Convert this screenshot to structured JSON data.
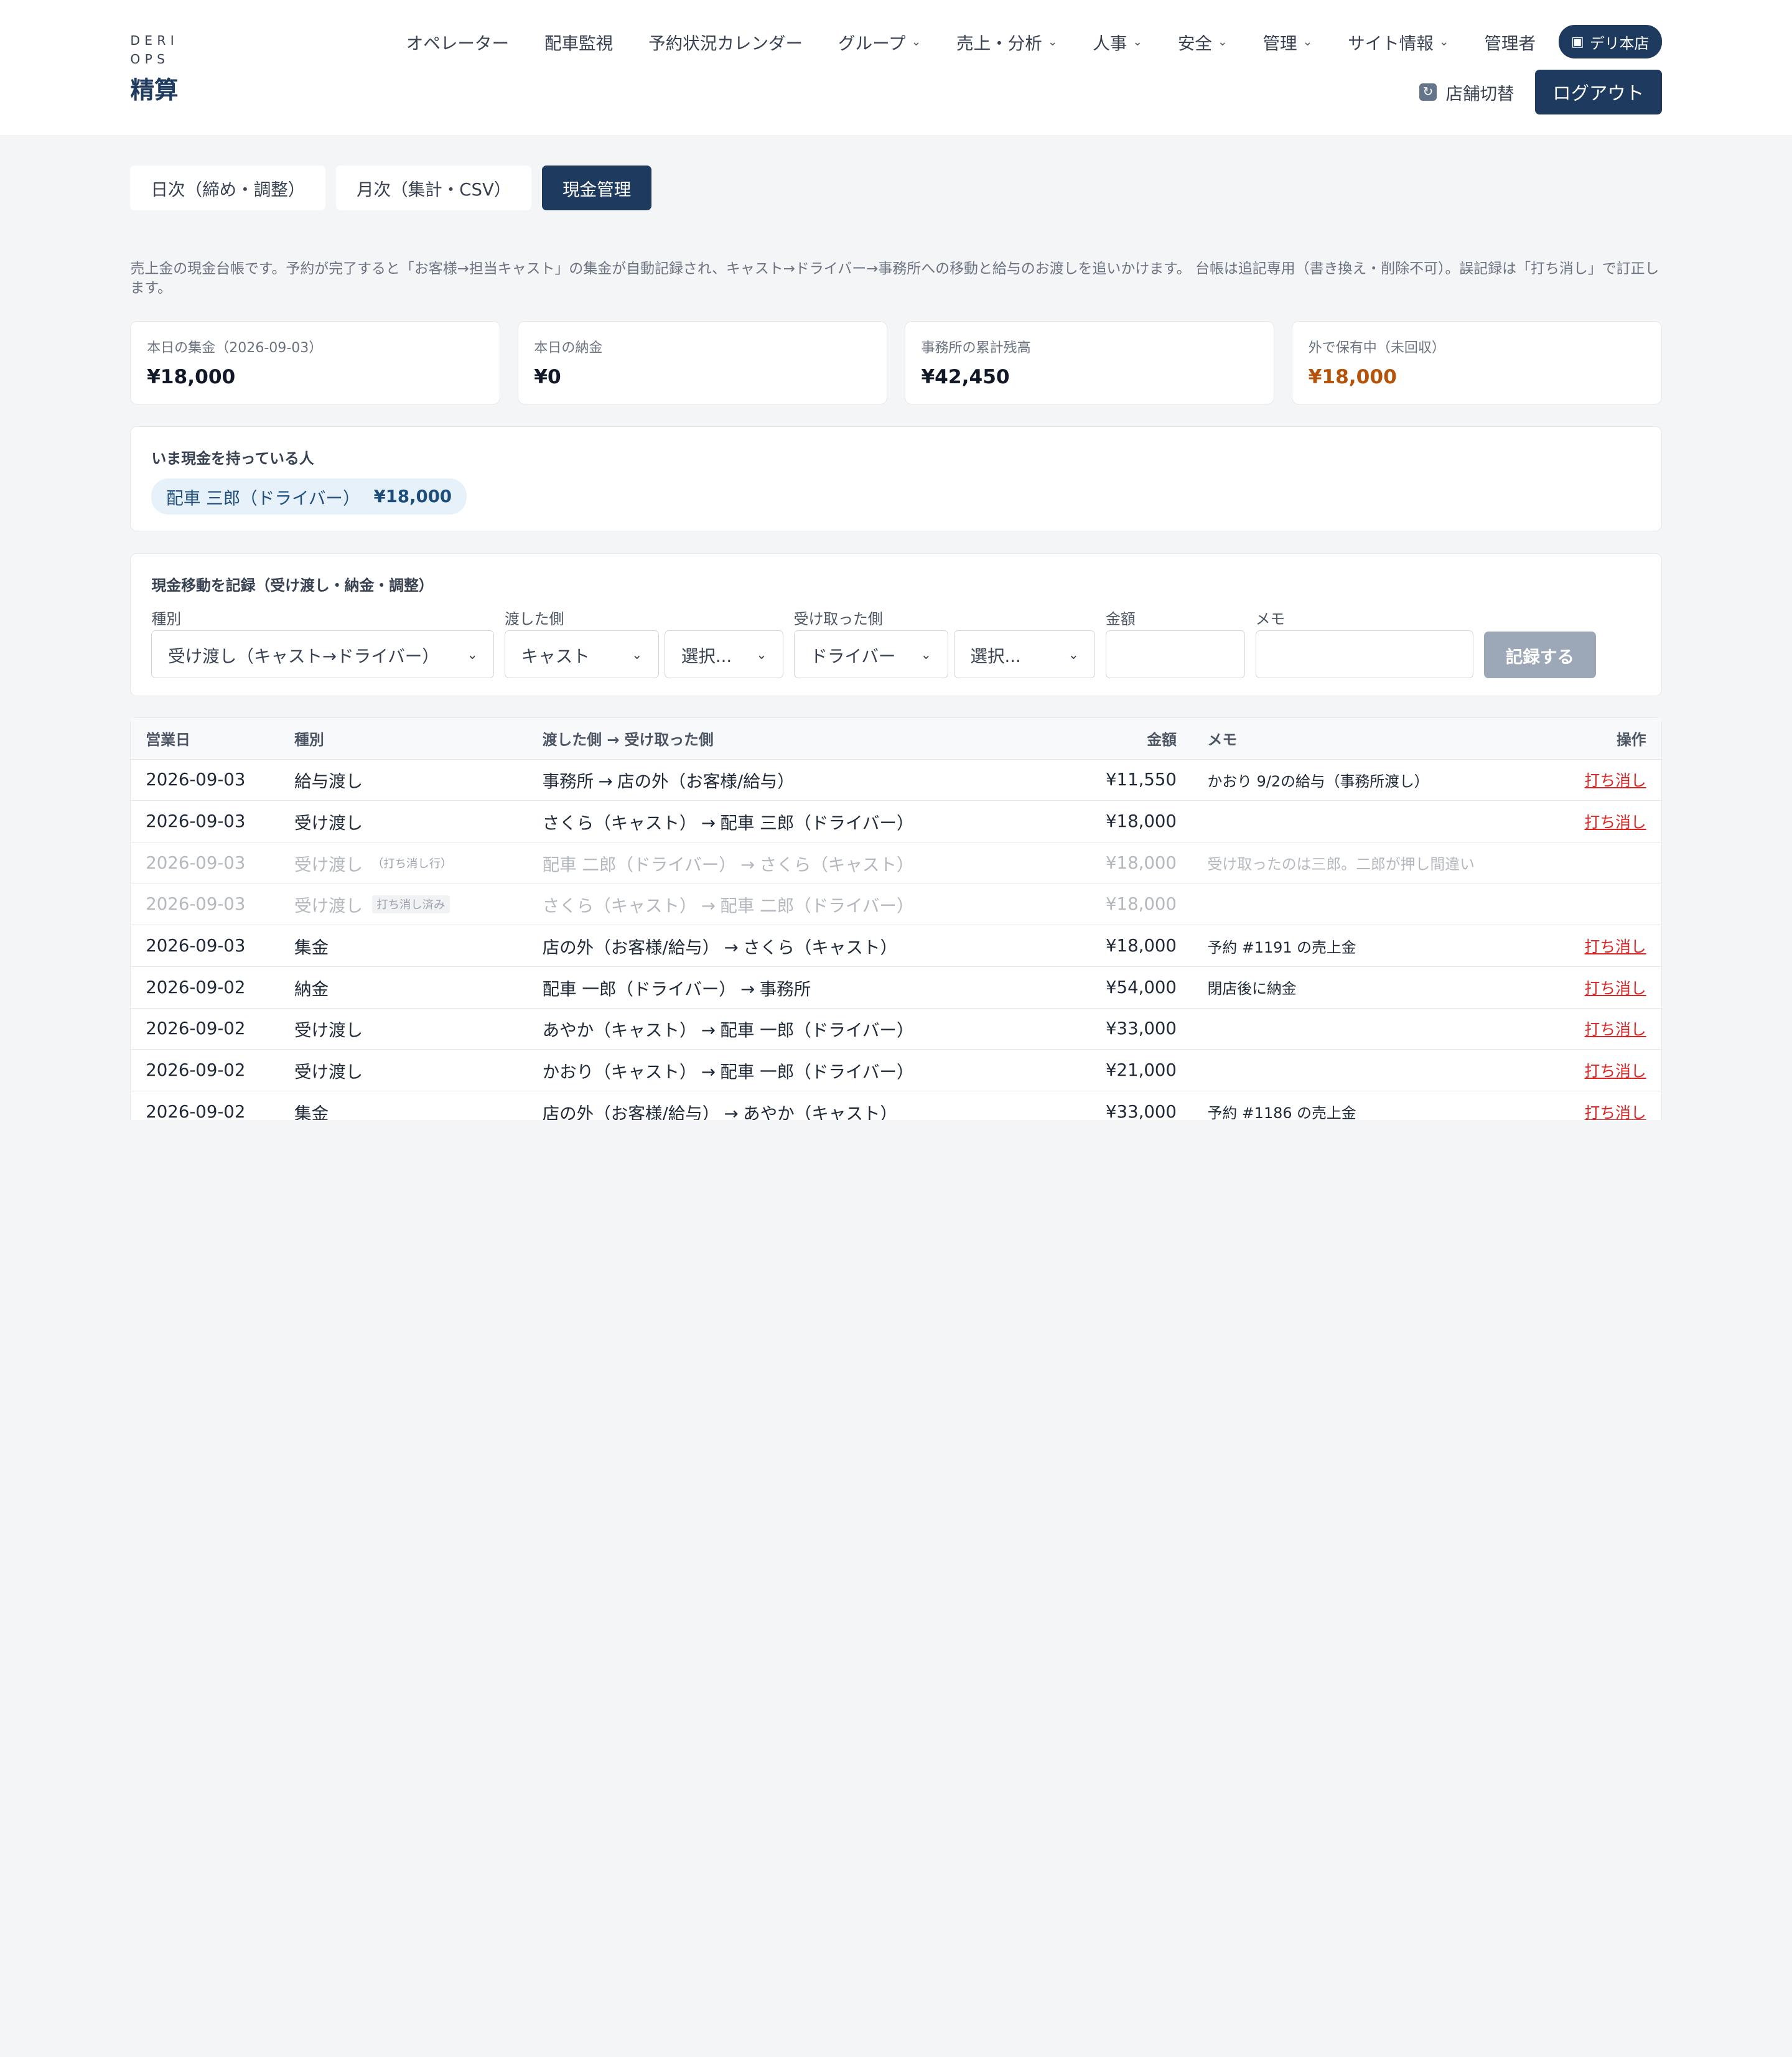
{
  "brand": {
    "logo": "DERI OPS",
    "title": "精算"
  },
  "nav": {
    "items": [
      {
        "label": "オペレーター",
        "dropdown": false
      },
      {
        "label": "配車監視",
        "dropdown": false
      },
      {
        "label": "予約状況カレンダー",
        "dropdown": false
      },
      {
        "label": "グループ",
        "dropdown": true
      },
      {
        "label": "売上・分析",
        "dropdown": true
      },
      {
        "label": "人事",
        "dropdown": true
      },
      {
        "label": "安全",
        "dropdown": true
      },
      {
        "label": "管理",
        "dropdown": true
      },
      {
        "label": "サイト情報",
        "dropdown": true
      },
      {
        "label": "管理者",
        "dropdown": false
      }
    ],
    "store_badge": "デリ本店",
    "switch_label": "店舗切替",
    "logout_label": "ログアウト"
  },
  "tabs": [
    {
      "label": "日次（締め・調整）",
      "active": false
    },
    {
      "label": "月次（集計・CSV）",
      "active": false
    },
    {
      "label": "現金管理",
      "active": true
    }
  ],
  "description": "売上金の現金台帳です。予約が完了すると「お客様→担当キャスト」の集金が自動記録され、キャスト→ドライバー→事務所への移動と給与のお渡しを追いかけます。 台帳は追記専用（書き換え・削除不可）。誤記録は「打ち消し」で訂正します。",
  "cards": [
    {
      "label": "本日の集金（2026-09-03）",
      "value": "¥18,000",
      "color": "#111827"
    },
    {
      "label": "本日の納金",
      "value": "¥0",
      "color": "#111827"
    },
    {
      "label": "事務所の累計残高",
      "value": "¥42,450",
      "color": "#111827"
    },
    {
      "label": "外で保有中（未回収）",
      "value": "¥18,000",
      "color": "#b45309"
    }
  ],
  "holders": {
    "title": "いま現金を持っている人",
    "chips": [
      {
        "name": "配車 三郎（ドライバー）",
        "amount": "¥18,000"
      }
    ]
  },
  "form": {
    "title": "現金移動を記録（受け渡し・納金・調整）",
    "kind_label": "種別",
    "kind_value": "受け渡し（キャスト→ドライバー）",
    "from_label": "渡した側",
    "from_role": "キャスト",
    "from_person": "選択...",
    "to_label": "受け取った側",
    "to_role": "ドライバー",
    "to_person": "選択...",
    "amount_label": "金額",
    "amount_value": "",
    "memo_label": "メモ",
    "memo_value": "",
    "submit_label": "記録する"
  },
  "table": {
    "headers": {
      "date": "営業日",
      "kind": "種別",
      "flow": "渡した側 → 受け取った側",
      "amount": "金額",
      "memo": "メモ",
      "op": "操作"
    },
    "rows": [
      {
        "date": "2026-09-03",
        "kind": "給与渡し",
        "tag": "",
        "from": "事務所",
        "to": "店の外（お客様/給与）",
        "amount": "¥11,550",
        "memo": "かおり 9/2の給与（事務所渡し）",
        "op": "打ち消し",
        "void": false
      },
      {
        "date": "2026-09-03",
        "kind": "受け渡し",
        "tag": "",
        "from": "さくら（キャスト）",
        "to": "配車 三郎（ドライバー）",
        "amount": "¥18,000",
        "memo": "",
        "op": "打ち消し",
        "void": false
      },
      {
        "date": "2026-09-03",
        "kind": "受け渡し",
        "tag": "（打ち消し行）",
        "from": "配車 二郎（ドライバー）",
        "to": "さくら（キャスト）",
        "amount": "¥18,000",
        "memo": "受け取ったのは三郎。二郎が押し間違い",
        "op": "",
        "void": true
      },
      {
        "date": "2026-09-03",
        "kind": "受け渡し",
        "tag": "打ち消し済み",
        "from": "さくら（キャスト）",
        "to": "配車 二郎（ドライバー）",
        "amount": "¥18,000",
        "memo": "",
        "op": "",
        "void": true
      },
      {
        "date": "2026-09-03",
        "kind": "集金",
        "tag": "",
        "from": "店の外（お客様/給与）",
        "to": "さくら（キャスト）",
        "amount": "¥18,000",
        "memo": "予約 #1191 の売上金",
        "op": "打ち消し",
        "void": false
      },
      {
        "date": "2026-09-02",
        "kind": "納金",
        "tag": "",
        "from": "配車 一郎（ドライバー）",
        "to": "事務所",
        "amount": "¥54,000",
        "memo": "閉店後に納金",
        "op": "打ち消し",
        "void": false
      },
      {
        "date": "2026-09-02",
        "kind": "受け渡し",
        "tag": "",
        "from": "あやか（キャスト）",
        "to": "配車 一郎（ドライバー）",
        "amount": "¥33,000",
        "memo": "",
        "op": "打ち消し",
        "void": false
      },
      {
        "date": "2026-09-02",
        "kind": "受け渡し",
        "tag": "",
        "from": "かおり（キャスト）",
        "to": "配車 一郎（ドライバー）",
        "amount": "¥21,000",
        "memo": "",
        "op": "打ち消し",
        "void": false
      },
      {
        "date": "2026-09-02",
        "kind": "集金",
        "tag": "",
        "from": "店の外（お客様/給与）",
        "to": "あやか（キャスト）",
        "amount": "¥33,000",
        "memo": "予約 #1186 の売上金",
        "op": "打ち消し",
        "void": false
      }
    ]
  }
}
